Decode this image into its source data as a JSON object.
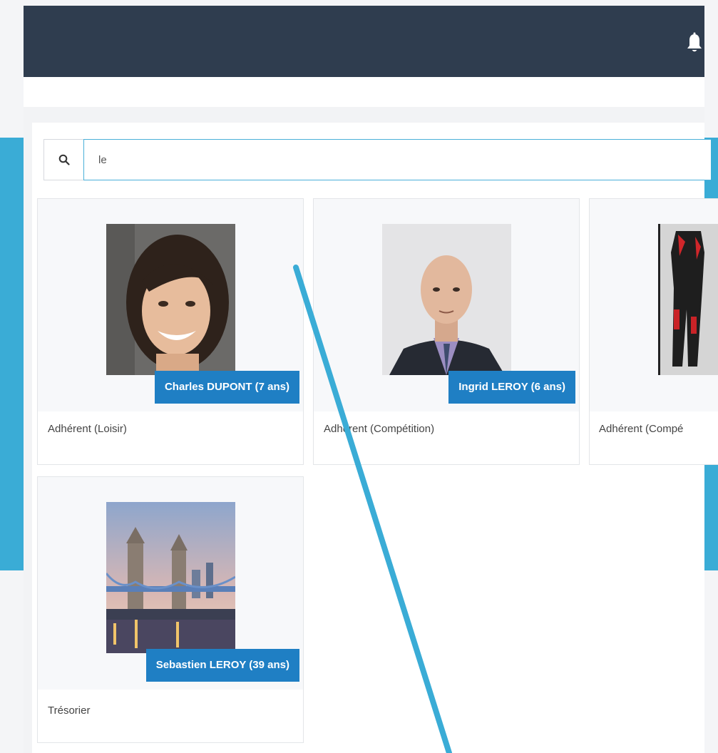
{
  "search": {
    "value": "le"
  },
  "icons": {
    "bell": "bell-icon",
    "search": "search-icon"
  },
  "colors": {
    "navbar": "#2f3d4f",
    "accent_bar": "#3aacd6",
    "badge": "#1f7fc4"
  },
  "members": [
    {
      "name": "Charles DUPONT (7 ans)",
      "role": "Adhérent (Loisir)"
    },
    {
      "name": "Ingrid LEROY (6 ans)",
      "role": "Adhérent (Compétition)"
    },
    {
      "name": "",
      "role": "Adhérent (Compé"
    },
    {
      "name": "Sebastien LEROY (39 ans)",
      "role": "Trésorier"
    }
  ]
}
